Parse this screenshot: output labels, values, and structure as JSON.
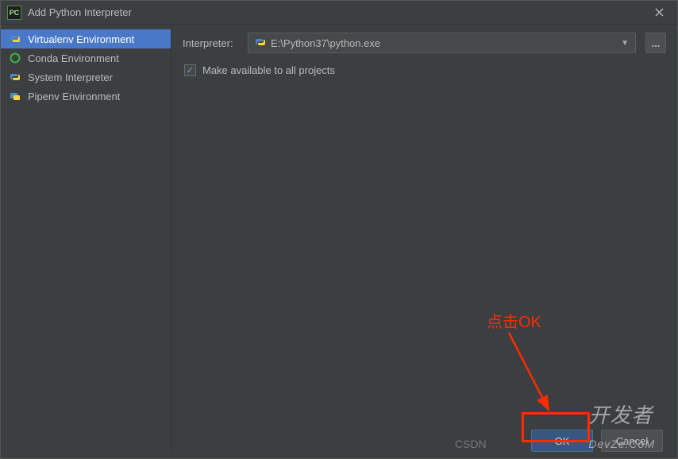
{
  "window": {
    "title": "Add Python Interpreter",
    "icon_label": "PC"
  },
  "sidebar": {
    "items": [
      {
        "label": "Virtualenv Environment",
        "selected": true,
        "icon": "python"
      },
      {
        "label": "Conda Environment",
        "selected": false,
        "icon": "conda"
      },
      {
        "label": "System Interpreter",
        "selected": false,
        "icon": "python"
      },
      {
        "label": "Pipenv Environment",
        "selected": false,
        "icon": "pipenv"
      }
    ]
  },
  "form": {
    "interpreter_label": "Interpreter:",
    "interpreter_value": "E:\\Python37\\python.exe",
    "browse_label": "...",
    "checkbox_checked": true,
    "checkbox_label": "Make available to all projects"
  },
  "buttons": {
    "ok": "OK",
    "cancel": "Cancel"
  },
  "annotation": {
    "text": "点击OK"
  },
  "watermarks": {
    "csdn": "CSDN",
    "devze": "开发者 DevZe.CoM"
  }
}
